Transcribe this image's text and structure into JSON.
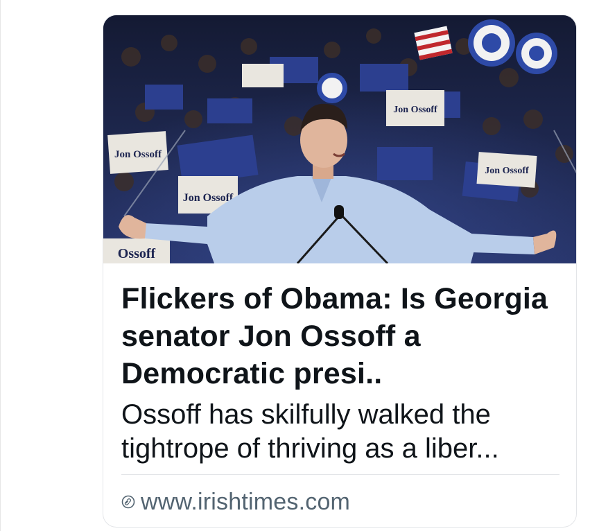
{
  "card": {
    "image": {
      "alt": "Jon Ossoff speaking at a rally",
      "signs": [
        "Jon Ossoff",
        "Jon Ossoff",
        "Jon Ossoff",
        "Jon Ossoff",
        "Ossoff"
      ]
    },
    "title": "Flickers of Obama: Is Georgia senator Jon Ossoff a Democratic presi..",
    "description": "Ossoff has skilfully walked the tightrope of thriving as a liber...",
    "source": {
      "icon": "link-icon",
      "domain": "www.irishtimes.com"
    }
  },
  "colors": {
    "text_primary": "#0f1419",
    "text_secondary": "#536471",
    "border": "#e3e5e8",
    "crowd_blue": "#2c3f8f",
    "shirt_blue": "#b9cdea"
  }
}
